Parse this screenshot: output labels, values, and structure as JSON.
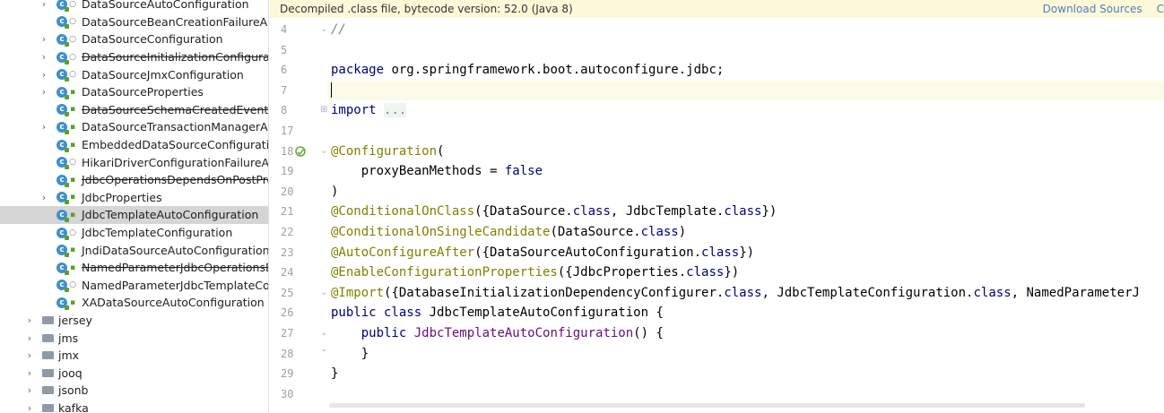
{
  "tree": {
    "items": [
      {
        "label": "DataSourceAutoConfiguration",
        "arrow": "›",
        "kind": "class",
        "vis": "pkg",
        "strike": false
      },
      {
        "label": "DataSourceBeanCreationFailureAnal",
        "arrow": "",
        "kind": "class",
        "vis": "pkg",
        "strike": false
      },
      {
        "label": "DataSourceConfiguration",
        "arrow": "›",
        "kind": "class",
        "vis": "pkg",
        "strike": false
      },
      {
        "label": "DataSourceInitializationConfiguratio",
        "arrow": "›",
        "kind": "class",
        "vis": "pkg",
        "strike": true
      },
      {
        "label": "DataSourceJmxConfiguration",
        "arrow": "›",
        "kind": "class",
        "vis": "pkg",
        "strike": false
      },
      {
        "label": "DataSourceProperties",
        "arrow": "›",
        "kind": "class",
        "vis": "pub",
        "strike": false
      },
      {
        "label": "DataSourceSchemaCreatedEvent",
        "arrow": "",
        "kind": "class",
        "vis": "pub",
        "strike": true
      },
      {
        "label": "DataSourceTransactionManagerAuto",
        "arrow": "›",
        "kind": "class",
        "vis": "pub",
        "strike": false
      },
      {
        "label": "EmbeddedDataSourceConfiguration",
        "arrow": "",
        "kind": "class",
        "vis": "pub",
        "strike": false
      },
      {
        "label": "HikariDriverConfigurationFailureAna",
        "arrow": "",
        "kind": "class",
        "vis": "pkg",
        "strike": false
      },
      {
        "label": "JdbcOperationsDependsOnPostProc",
        "arrow": "",
        "kind": "class",
        "vis": "pub",
        "strike": true
      },
      {
        "label": "JdbcProperties",
        "arrow": "›",
        "kind": "class",
        "vis": "pub",
        "strike": false
      },
      {
        "label": "JdbcTemplateAutoConfiguration",
        "arrow": "",
        "kind": "class",
        "vis": "pub",
        "strike": false,
        "selected": true
      },
      {
        "label": "JdbcTemplateConfiguration",
        "arrow": "",
        "kind": "class",
        "vis": "pkg",
        "strike": false
      },
      {
        "label": "JndiDataSourceAutoConfiguration",
        "arrow": "",
        "kind": "class",
        "vis": "pub",
        "strike": false
      },
      {
        "label": "NamedParameterJdbcOperationsDe",
        "arrow": "",
        "kind": "class",
        "vis": "pub",
        "strike": true
      },
      {
        "label": "NamedParameterJdbcTemplateCon",
        "arrow": "",
        "kind": "class",
        "vis": "pkg",
        "strike": false
      },
      {
        "label": "XADataSourceAutoConfiguration",
        "arrow": "",
        "kind": "class",
        "vis": "pub",
        "strike": false
      },
      {
        "label": "jersey",
        "arrow": "›",
        "kind": "folder"
      },
      {
        "label": "jms",
        "arrow": "›",
        "kind": "folder"
      },
      {
        "label": "jmx",
        "arrow": "›",
        "kind": "folder"
      },
      {
        "label": "jooq",
        "arrow": "›",
        "kind": "folder"
      },
      {
        "label": "jsonb",
        "arrow": "›",
        "kind": "folder"
      },
      {
        "label": "kafka",
        "arrow": "›",
        "kind": "folder"
      }
    ]
  },
  "banner": {
    "message": "Decompiled .class file, bytecode version: 52.0 (Java 8)",
    "download_sources": "Download Sources",
    "next_link": "C"
  },
  "editor": {
    "line_numbers": [
      "4",
      "5",
      "6",
      "7",
      "8",
      "17",
      "18",
      "19",
      "20",
      "21",
      "22",
      "23",
      "24",
      "25",
      "26",
      "27",
      "28",
      "29",
      "30"
    ],
    "current_line_index": 3,
    "lines": [
      [
        {
          "t": "//",
          "c": "cm"
        }
      ],
      [],
      [
        {
          "t": "package",
          "c": "kw"
        },
        {
          "t": " org.springframework.boot.autoconfigure.jdbc;",
          "c": ""
        }
      ],
      [],
      [
        {
          "t": "import",
          "c": "kw"
        },
        {
          "t": " ",
          "c": ""
        },
        {
          "t": "...",
          "c": "fo"
        }
      ],
      [],
      [
        {
          "t": "@Configuration",
          "c": "an"
        },
        {
          "t": "(",
          "c": ""
        }
      ],
      [
        {
          "t": "    proxyBeanMethods = ",
          "c": ""
        },
        {
          "t": "false",
          "c": "kw"
        }
      ],
      [
        {
          "t": ")",
          "c": ""
        }
      ],
      [
        {
          "t": "@ConditionalOnClass",
          "c": "an"
        },
        {
          "t": "({DataSource.",
          "c": ""
        },
        {
          "t": "class",
          "c": "kw"
        },
        {
          "t": ", JdbcTemplate.",
          "c": ""
        },
        {
          "t": "class",
          "c": "kw"
        },
        {
          "t": "})",
          "c": ""
        }
      ],
      [
        {
          "t": "@ConditionalOnSingleCandidate",
          "c": "an"
        },
        {
          "t": "(DataSource.",
          "c": ""
        },
        {
          "t": "class",
          "c": "kw"
        },
        {
          "t": ")",
          "c": ""
        }
      ],
      [
        {
          "t": "@AutoConfigureAfter",
          "c": "an"
        },
        {
          "t": "({DataSourceAutoConfiguration.",
          "c": ""
        },
        {
          "t": "class",
          "c": "kw"
        },
        {
          "t": "})",
          "c": ""
        }
      ],
      [
        {
          "t": "@EnableConfigurationProperties",
          "c": "an"
        },
        {
          "t": "({JdbcProperties.",
          "c": ""
        },
        {
          "t": "class",
          "c": "kw"
        },
        {
          "t": "})",
          "c": ""
        }
      ],
      [
        {
          "t": "@Import",
          "c": "an"
        },
        {
          "t": "({DatabaseInitializationDependencyConfigurer.",
          "c": ""
        },
        {
          "t": "class",
          "c": "kw"
        },
        {
          "t": ", JdbcTemplateConfiguration.",
          "c": ""
        },
        {
          "t": "class",
          "c": "kw"
        },
        {
          "t": ", NamedParameterJ",
          "c": ""
        }
      ],
      [
        {
          "t": "public class",
          "c": "kw"
        },
        {
          "t": " JdbcTemplateAutoConfiguration {",
          "c": ""
        }
      ],
      [
        {
          "t": "    ",
          "c": ""
        },
        {
          "t": "public",
          "c": "kw"
        },
        {
          "t": " ",
          "c": ""
        },
        {
          "t": "JdbcTemplateAutoConfiguration",
          "c": "fd"
        },
        {
          "t": "() {",
          "c": ""
        }
      ],
      [
        {
          "t": "    }",
          "c": ""
        }
      ],
      [
        {
          "t": "}",
          "c": ""
        }
      ],
      []
    ],
    "folds": {
      "0": "⌄",
      "4": "⊞",
      "6": "⌄",
      "13": "⌄",
      "15": "⌄",
      "16": "⌃"
    },
    "bean_icon_line": 6
  }
}
